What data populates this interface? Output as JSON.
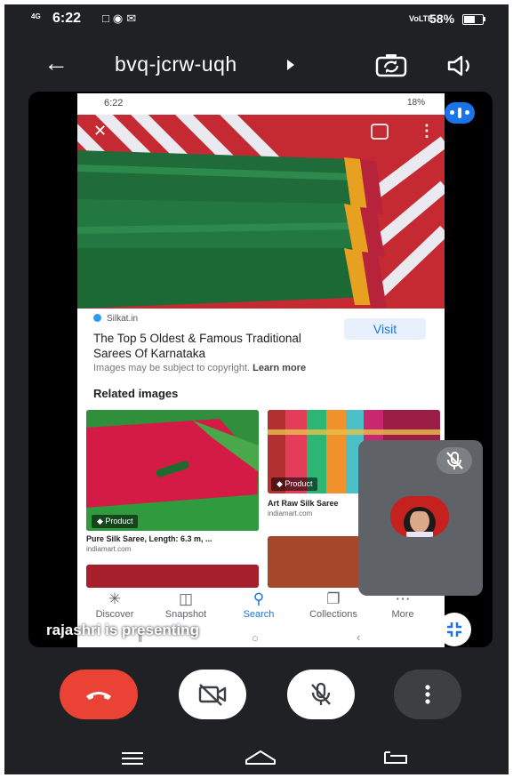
{
  "status_bar": {
    "network": "4G",
    "time": "6:22",
    "volte": "VoLTE",
    "battery": "58%",
    "battery_level": 0.58
  },
  "header": {
    "meeting_code": "bvq-jcrw-uqh"
  },
  "shared_screen": {
    "status_time": "6:22",
    "status_right": "18%",
    "source": "Silkat.in",
    "visit_label": "Visit",
    "article_title": "The Top 5 Oldest & Famous Traditional Sarees Of Karnataka",
    "copyright_text": "Images may be subject to copyright.",
    "learn_more": "Learn more",
    "related_heading": "Related images",
    "thumbs": [
      {
        "badge": "Product",
        "caption": "Pure Silk Saree, Length: 6.3 m, ...",
        "source": "indiamart.com"
      },
      {
        "badge": "Product",
        "caption": "Art Raw Silk Saree",
        "source": "indiamart.com"
      }
    ],
    "bottom_nav": [
      {
        "label": "Discover",
        "icon": "asterisk-icon"
      },
      {
        "label": "Snapshot",
        "icon": "snapshot-icon"
      },
      {
        "label": "Search",
        "icon": "search-icon"
      },
      {
        "label": "Collections",
        "icon": "collections-icon"
      },
      {
        "label": "More",
        "icon": "more-dots-icon"
      }
    ]
  },
  "presenting_label": "rajashri is presenting",
  "colors": {
    "background": "#202124",
    "end_call": "#ea4335",
    "accent": "#1a73e8",
    "self_view": "#5f6368"
  }
}
